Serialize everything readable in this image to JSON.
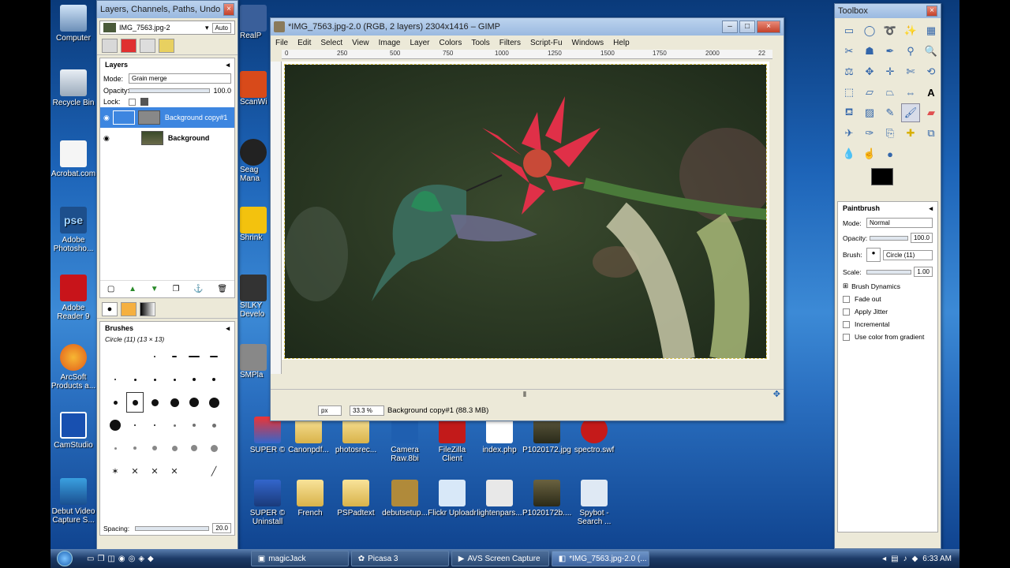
{
  "desktop": {
    "left_icons": [
      {
        "label": "Computer"
      },
      {
        "label": "Recycle Bin"
      },
      {
        "label": "Acrobat.com"
      },
      {
        "label": "Adobe Photosho..."
      },
      {
        "label": "Adobe Reader 9"
      },
      {
        "label": "ArcSoft Products a..."
      },
      {
        "label": "CamStudio"
      },
      {
        "label": "Debut Video Capture S..."
      }
    ],
    "mid_icons": [
      {
        "label": "RealP"
      },
      {
        "label": "ScanWi"
      },
      {
        "label": "Seag Mana"
      },
      {
        "label": "Shrink"
      },
      {
        "label": "SILKY Develo"
      },
      {
        "label": "SMPla"
      },
      {
        "label": "SUPER ©"
      },
      {
        "label": "SUPER © Uninstall"
      }
    ],
    "row1": [
      {
        "label": "Canonpdf..."
      },
      {
        "label": "photosrec..."
      },
      {
        "label": "Camera Raw.8bi"
      },
      {
        "label": "FileZilla Client"
      },
      {
        "label": "index.php"
      },
      {
        "label": "P1020172.jpg"
      },
      {
        "label": "spectro.swf"
      }
    ],
    "row2": [
      {
        "label": "French"
      },
      {
        "label": "PSPadtext"
      },
      {
        "label": "debutsetup..."
      },
      {
        "label": "Flickr Uploadr"
      },
      {
        "label": "lightenpars..."
      },
      {
        "label": "P1020172b...."
      },
      {
        "label": "Spybot - Search ..."
      }
    ]
  },
  "layers_dock": {
    "title": "Layers, Channels, Paths, Undo - Brus...",
    "image_select": "IMG_7563.jpg-2",
    "auto_label": "Auto",
    "layers_heading": "Layers",
    "mode_label": "Mode:",
    "mode_value": "Grain merge",
    "opacity_label": "Opacity:",
    "opacity_value": "100.0",
    "lock_label": "Lock:",
    "layers": [
      {
        "name": "Background copy#1",
        "selected": true
      },
      {
        "name": "Background",
        "selected": false
      }
    ],
    "brushes_heading": "Brushes",
    "brush_info": "Circle (11) (13 × 13)",
    "spacing_label": "Spacing:",
    "spacing_value": "20.0"
  },
  "image_window": {
    "title": "*IMG_7563.jpg-2.0 (RGB, 2 layers) 2304x1416 – GIMP",
    "menus": [
      "File",
      "Edit",
      "Select",
      "View",
      "Image",
      "Layer",
      "Colors",
      "Tools",
      "Filters",
      "Script-Fu",
      "Windows",
      "Help"
    ],
    "ruler_ticks": [
      "0",
      "250",
      "500",
      "750",
      "1000",
      "1250",
      "1500",
      "1750",
      "2000",
      "22"
    ],
    "unit": "px",
    "zoom": "33.3 %",
    "status": "Background copy#1 (88.3 MB)"
  },
  "toolbox": {
    "title": "Toolbox",
    "tool_options_title": "Paintbrush",
    "mode_label": "Mode:",
    "mode_value": "Normal",
    "opacity_label": "Opacity:",
    "opacity_value": "100.0",
    "brush_label": "Brush:",
    "brush_value": "Circle (11)",
    "scale_label": "Scale:",
    "scale_value": "1.00",
    "brush_dynamics": "Brush Dynamics",
    "options": [
      "Fade out",
      "Apply Jitter",
      "Incremental",
      "Use color from gradient"
    ]
  },
  "taskbar": {
    "items": [
      {
        "label": "magicJack",
        "active": false
      },
      {
        "label": "Picasa 3",
        "active": false
      },
      {
        "label": "AVS Screen Capture",
        "active": false
      },
      {
        "label": "*IMG_7563.jpg-2.0 (...",
        "active": true
      }
    ],
    "clock": "6:33 AM"
  }
}
